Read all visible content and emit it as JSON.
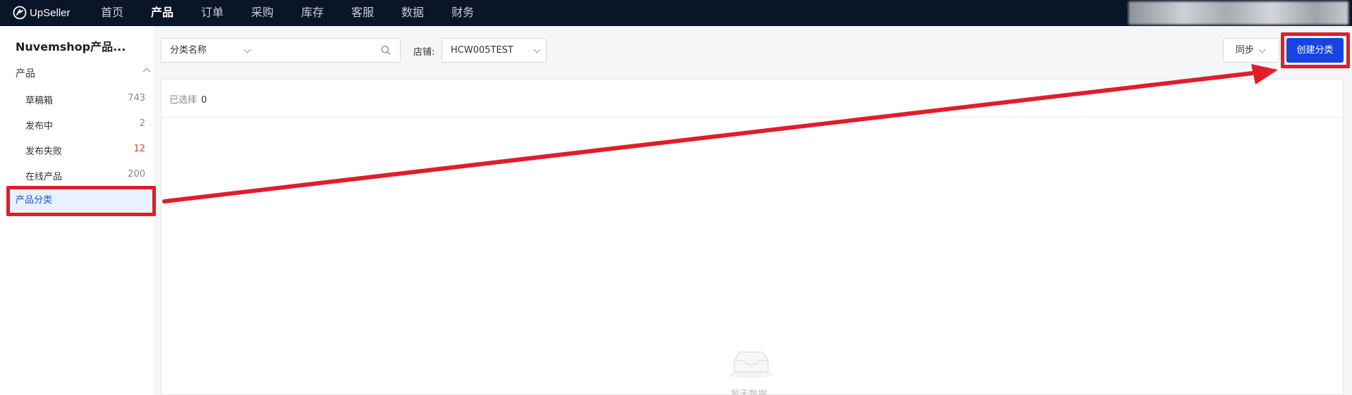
{
  "header": {
    "logo_text": "UpSeller",
    "nav": [
      "首页",
      "产品",
      "订单",
      "采购",
      "库存",
      "客服",
      "数据",
      "财务"
    ],
    "active_nav": "产品"
  },
  "sidebar": {
    "store_title": "Nuvemshop产品...",
    "group_label": "产品",
    "items": [
      {
        "label": "草稿箱",
        "count": "743"
      },
      {
        "label": "发布中",
        "count": "2"
      },
      {
        "label": "发布失败",
        "count": "12"
      },
      {
        "label": "在线产品",
        "count": "200"
      },
      {
        "label": "产品分类"
      }
    ]
  },
  "toolbar": {
    "filter_select": "分类名称",
    "search_placeholder": "",
    "store_label": "店铺:",
    "store_value": "HCW005TEST",
    "sync_label": "同步",
    "create_label": "创建分类"
  },
  "content": {
    "selected_label": "已选择",
    "selected_count": "0",
    "empty_text": "暂无数据"
  },
  "colors": {
    "topbar": "#0b1528",
    "primary": "#1545e0",
    "annotation": "#e11d2a",
    "error_count": "#e53935"
  }
}
